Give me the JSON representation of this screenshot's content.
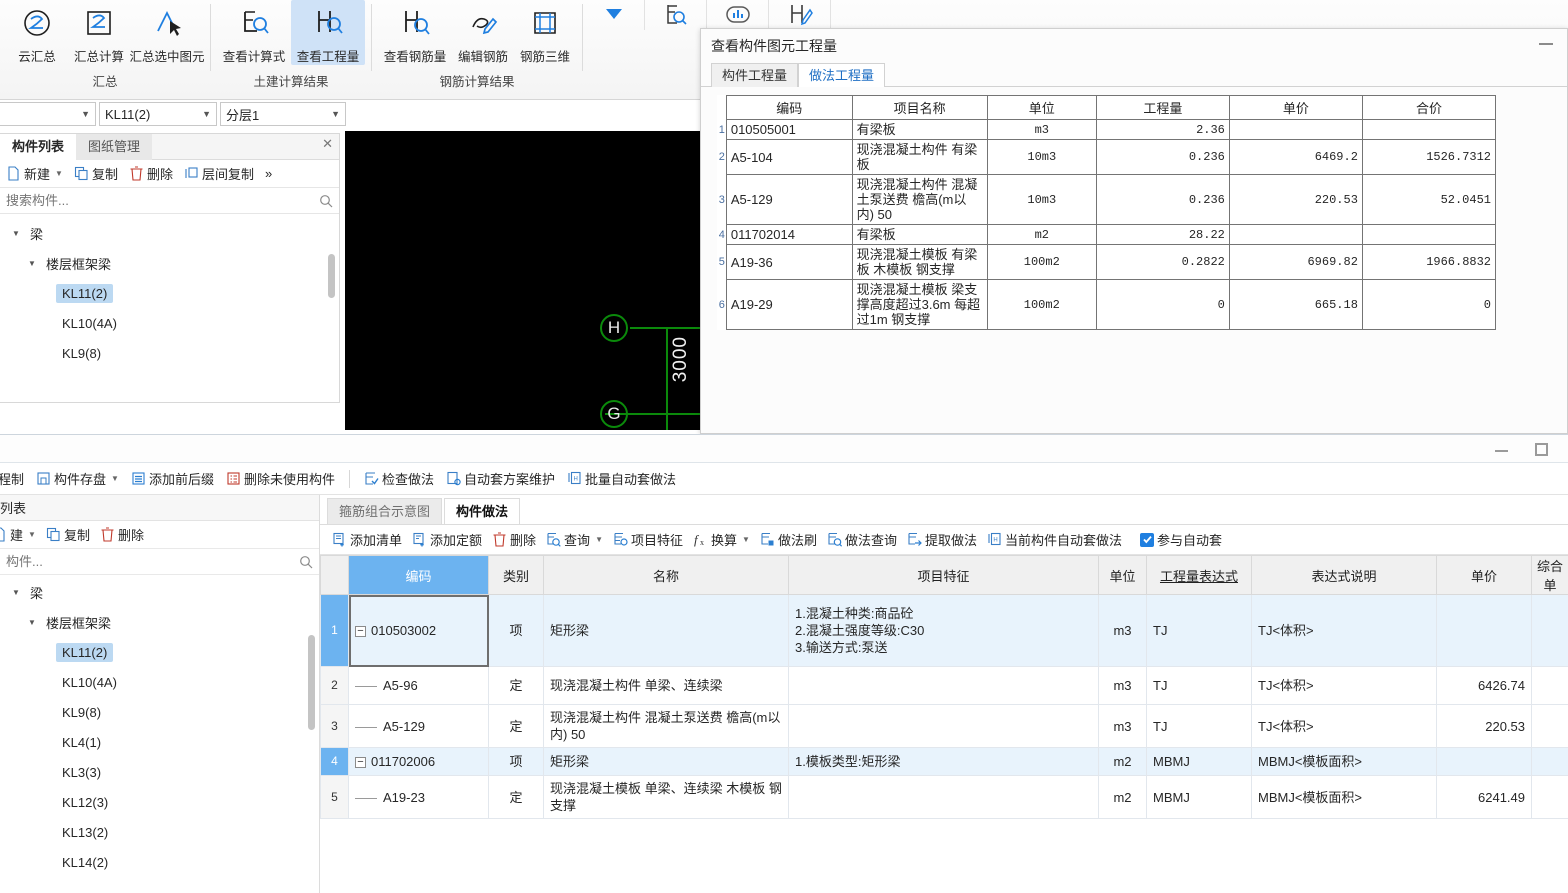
{
  "ribbon": {
    "groups": [
      {
        "label": "汇总",
        "buttons": [
          {
            "label": "云汇总",
            "icon": "cloud-summary-icon",
            "active": false
          },
          {
            "label": "汇总计算",
            "icon": "summary-calc-icon",
            "active": false
          },
          {
            "label": "汇总选中图元",
            "icon": "summary-selected-icon",
            "active": false
          }
        ]
      },
      {
        "label": "土建计算结果",
        "buttons": [
          {
            "label": "查看计算式",
            "icon": "view-formula-icon",
            "active": false
          },
          {
            "label": "查看工程量",
            "icon": "view-quantity-icon",
            "active": true
          }
        ]
      },
      {
        "label": "钢筋计算结果",
        "buttons": [
          {
            "label": "查看钢筋量",
            "icon": "view-rebar-qty-icon",
            "active": false
          },
          {
            "label": "编辑钢筋",
            "icon": "edit-rebar-icon",
            "active": false
          },
          {
            "label": "钢筋三维",
            "icon": "rebar-3d-icon",
            "active": false
          }
        ]
      }
    ],
    "mini_icons": [
      "blue-chevron-down-icon",
      "report-search-icon",
      "cloud-chart-icon",
      "table-edit-icon"
    ]
  },
  "combo_bar": {
    "items": [
      {
        "value": "",
        "name": "member-type-combo"
      },
      {
        "value": "KL11(2)",
        "name": "member-name-combo"
      },
      {
        "value": "分层1",
        "name": "layer-combo"
      }
    ]
  },
  "left_panel": {
    "tabs": [
      {
        "label": "构件列表",
        "active": true
      },
      {
        "label": "图纸管理",
        "active": false
      }
    ],
    "toolbar": [
      {
        "label": "新建",
        "icon": "new-icon",
        "caret": true
      },
      {
        "label": "复制",
        "icon": "copy-icon",
        "caret": false
      },
      {
        "label": "删除",
        "icon": "delete-icon",
        "caret": false
      },
      {
        "label": "层间复制",
        "icon": "copy-between-floors-icon",
        "caret": false
      }
    ],
    "overflow": "»",
    "search_placeholder": "搜索构件...",
    "tree": [
      {
        "label": "梁",
        "level": 1,
        "expanded": true,
        "selected": false
      },
      {
        "label": "楼层框架梁",
        "level": 2,
        "expanded": true,
        "selected": false
      },
      {
        "label": "KL11(2)",
        "level": 3,
        "expanded": false,
        "selected": true
      },
      {
        "label": "KL10(4A)",
        "level": 3,
        "expanded": false,
        "selected": false
      },
      {
        "label": "KL9(8)",
        "level": 3,
        "expanded": false,
        "selected": false
      }
    ]
  },
  "canvas": {
    "axis_labels": [
      "H",
      "G"
    ],
    "dimension": "3000"
  },
  "dialog": {
    "title": "查看构件图元工程量",
    "minimize": "minimize-icon",
    "tabs": [
      {
        "label": "构件工程量",
        "active": false
      },
      {
        "label": "做法工程量",
        "active": true
      }
    ],
    "table": {
      "headers": [
        "编码",
        "项目名称",
        "单位",
        "工程量",
        "单价",
        "合价"
      ],
      "rows": [
        {
          "n": "1",
          "code": "010505001",
          "name": "有梁板",
          "unit": "m3",
          "qty": "2.36",
          "price": "",
          "total": ""
        },
        {
          "n": "2",
          "code": "A5-104",
          "name": "现浇混凝土构件 有梁板",
          "unit": "10m3",
          "qty": "0.236",
          "price": "6469.2",
          "total": "1526.7312"
        },
        {
          "n": "3",
          "code": "A5-129",
          "name": "现浇混凝土构件 混凝土泵送费 檐高(m以内) 50",
          "unit": "10m3",
          "qty": "0.236",
          "price": "220.53",
          "total": "52.0451"
        },
        {
          "n": "4",
          "code": "011702014",
          "name": "有梁板",
          "unit": "m2",
          "qty": "28.22",
          "price": "",
          "total": ""
        },
        {
          "n": "5",
          "code": "A19-36",
          "name": "现浇混凝土模板 有梁板 木模板 钢支撑",
          "unit": "100m2",
          "qty": "0.2822",
          "price": "6969.82",
          "total": "1966.8832"
        },
        {
          "n": "6",
          "code": "A19-29",
          "name": "现浇混凝土模板 梁支撑高度超过3.6m 每超过1m 钢支撑",
          "unit": "100m2",
          "qty": "0",
          "price": "665.18",
          "total": "0"
        }
      ]
    }
  },
  "bottom_window": {
    "window_controls": [
      "minimize-icon",
      "maximize-icon"
    ],
    "toolbar": [
      {
        "label": "程制",
        "icon": "copy-icon",
        "caret": false,
        "sep_after": false
      },
      {
        "label": "构件存盘",
        "icon": "save-member-icon",
        "caret": true,
        "sep_after": false
      },
      {
        "label": "添加前后缀",
        "icon": "add-affix-icon",
        "caret": false,
        "sep_after": false
      },
      {
        "label": "删除未使用构件",
        "icon": "delete-unused-icon",
        "caret": false,
        "sep_after": true
      },
      {
        "label": "检查做法",
        "icon": "check-method-icon",
        "caret": false,
        "sep_after": false
      },
      {
        "label": "自动套方案维护",
        "icon": "auto-scheme-icon",
        "caret": false,
        "sep_after": false
      },
      {
        "label": "批量自动套做法",
        "icon": "batch-auto-icon",
        "caret": false,
        "sep_after": false
      }
    ],
    "left": {
      "header": "列表",
      "tools": [
        {
          "label": "建",
          "icon": "new-icon",
          "caret": true
        },
        {
          "label": "复制",
          "icon": "copy-icon",
          "caret": false
        },
        {
          "label": "删除",
          "icon": "delete-icon",
          "caret": false
        }
      ],
      "search_placeholder": "构件...",
      "tree": [
        {
          "label": "梁",
          "level": 1,
          "expanded": true,
          "selected": false
        },
        {
          "label": "楼层框架梁",
          "level": 2,
          "expanded": true,
          "selected": false
        },
        {
          "label": "KL11(2)",
          "level": 3,
          "expanded": false,
          "selected": true
        },
        {
          "label": "KL10(4A)",
          "level": 3,
          "expanded": false,
          "selected": false
        },
        {
          "label": "KL9(8)",
          "level": 3,
          "expanded": false,
          "selected": false
        },
        {
          "label": "KL4(1)",
          "level": 3,
          "expanded": false,
          "selected": false
        },
        {
          "label": "KL3(3)",
          "level": 3,
          "expanded": false,
          "selected": false
        },
        {
          "label": "KL12(3)",
          "level": 3,
          "expanded": false,
          "selected": false
        },
        {
          "label": "KL13(2)",
          "level": 3,
          "expanded": false,
          "selected": false
        },
        {
          "label": "KL14(2)",
          "level": 3,
          "expanded": false,
          "selected": false
        }
      ]
    },
    "right": {
      "tabs": [
        {
          "label": "箍筋组合示意图",
          "active": false
        },
        {
          "label": "构件做法",
          "active": true
        }
      ],
      "toolbar": [
        {
          "label": "添加清单",
          "icon": "add-list-icon",
          "caret": false
        },
        {
          "label": "添加定额",
          "icon": "add-quota-icon",
          "caret": false
        },
        {
          "label": "删除",
          "icon": "delete-icon",
          "caret": false
        },
        {
          "label": "查询",
          "icon": "query-icon",
          "caret": true
        },
        {
          "label": "项目特征",
          "icon": "project-feature-icon",
          "caret": false
        },
        {
          "label": "换算",
          "icon": "conversion-fx-icon",
          "caret": true
        },
        {
          "label": "做法刷",
          "icon": "method-brush-icon",
          "caret": false
        },
        {
          "label": "做法查询",
          "icon": "method-query-icon",
          "caret": false
        },
        {
          "label": "提取做法",
          "icon": "extract-method-icon",
          "caret": false
        },
        {
          "label": "当前构件自动套做法",
          "icon": "current-auto-icon",
          "caret": false
        }
      ],
      "checkbox": {
        "label": "参与自动套",
        "checked": true
      },
      "table": {
        "headers": [
          {
            "label": "编码",
            "selected": true,
            "underline": false
          },
          {
            "label": "类别",
            "selected": false,
            "underline": false
          },
          {
            "label": "名称",
            "selected": false,
            "underline": false
          },
          {
            "label": "项目特征",
            "selected": false,
            "underline": false
          },
          {
            "label": "单位",
            "selected": false,
            "underline": false
          },
          {
            "label": "工程量表达式",
            "selected": false,
            "underline": true
          },
          {
            "label": "表达式说明",
            "selected": false,
            "underline": false
          },
          {
            "label": "单价",
            "selected": false,
            "underline": false
          },
          {
            "label": "综合单",
            "selected": false,
            "underline": false
          }
        ],
        "rows": [
          {
            "n": "1",
            "code": "010503002",
            "marker": "expander",
            "kind": "项",
            "name": "矩形梁",
            "features": [
              "1.混凝土种类:商品砼",
              "2.混凝土强度等级:C30",
              "3.输送方式:泵送"
            ],
            "unit": "m3",
            "expr": "TJ",
            "expr_desc": "TJ<体积>",
            "price": "",
            "comp_price": "",
            "highlight": true,
            "boxed": true
          },
          {
            "n": "2",
            "code": "A5-96",
            "marker": "stub",
            "kind": "定",
            "name": "现浇混凝土构件 单梁、连续梁",
            "features": [],
            "unit": "m3",
            "expr": "TJ",
            "expr_desc": "TJ<体积>",
            "price": "6426.74",
            "comp_price": "",
            "highlight": false,
            "boxed": false
          },
          {
            "n": "3",
            "code": "A5-129",
            "marker": "stub",
            "kind": "定",
            "name": "现浇混凝土构件 混凝土泵送费 檐高(m以内) 50",
            "features": [],
            "unit": "m3",
            "expr": "TJ",
            "expr_desc": "TJ<体积>",
            "price": "220.53",
            "comp_price": "",
            "highlight": false,
            "boxed": false
          },
          {
            "n": "4",
            "code": "011702006",
            "marker": "expander",
            "kind": "项",
            "name": "矩形梁",
            "features": [
              "1.模板类型:矩形梁"
            ],
            "unit": "m2",
            "expr": "MBMJ",
            "expr_desc": "MBMJ<模板面积>",
            "price": "",
            "comp_price": "",
            "highlight": true,
            "boxed": false
          },
          {
            "n": "5",
            "code": "A19-23",
            "marker": "stub",
            "kind": "定",
            "name": "现浇混凝土模板 单梁、连续梁 木模板 钢支撑",
            "features": [],
            "unit": "m2",
            "expr": "MBMJ",
            "expr_desc": "MBMJ<模板面积>",
            "price": "6241.49",
            "comp_price": "",
            "highlight": false,
            "boxed": false
          }
        ]
      }
    }
  }
}
